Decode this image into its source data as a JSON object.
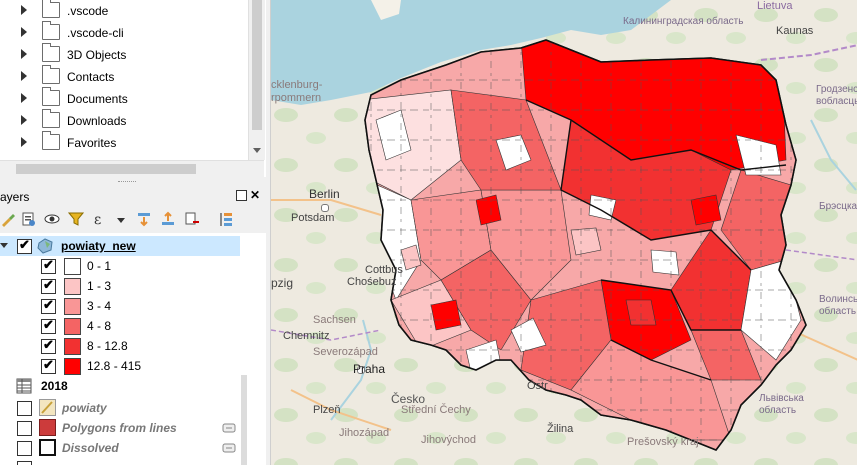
{
  "browser": {
    "items": [
      ".vscode",
      ".vscode-cli",
      "3D Objects",
      "Contacts",
      "Documents",
      "Downloads",
      "Favorites"
    ]
  },
  "layers_panel": {
    "title": "ayers",
    "layers": [
      {
        "name": "powiaty_new",
        "checked": true,
        "expanded": true
      },
      {
        "name": "2018"
      },
      {
        "name": "powiaty",
        "checked": false
      },
      {
        "name": "Polygons from lines",
        "checked": false
      },
      {
        "name": "Dissolved",
        "checked": false
      }
    ],
    "legend": [
      {
        "label": "0 - 1",
        "color": "#ffffff"
      },
      {
        "label": "1 - 3",
        "color": "#fcc5c5"
      },
      {
        "label": "3 - 4",
        "color": "#f99696"
      },
      {
        "label": "4 - 8",
        "color": "#f46464"
      },
      {
        "label": "8 - 12.8",
        "color": "#f23131"
      },
      {
        "label": "12.8 - 415",
        "color": "#ff0000"
      }
    ]
  },
  "map": {
    "labels": {
      "lietuva": "Lietuva",
      "kaliningrad": "Калининградская область",
      "kaunas": "Kaunas",
      "mecklenburg": "cklenburg-",
      "vorpommern": "rpommern",
      "grodno": "Гродзенская вобласць",
      "berlin": "Berlin",
      "potsdam": "Potsdam",
      "brest": "Брэсцкая",
      "cottbus": "Cottbus",
      "chosebuz": "Chośebuz",
      "pzig": "pzig",
      "sachsen": "Sachsen",
      "volyn": "Волинська область",
      "chemnitz": "Chemnitz",
      "severozapad": "Severozápad",
      "praha": "Praha",
      "cesko": "Česko",
      "plzen": "Plzeň",
      "stredni_cechy": "Střední Čechy",
      "jihozapad": "Jihozápad",
      "jihovychod": "Jihovýchod",
      "zilina": "Žilina",
      "presov": "Prešovský kraj",
      "lviv": "Львівська область",
      "ostr": "Ostr"
    }
  }
}
